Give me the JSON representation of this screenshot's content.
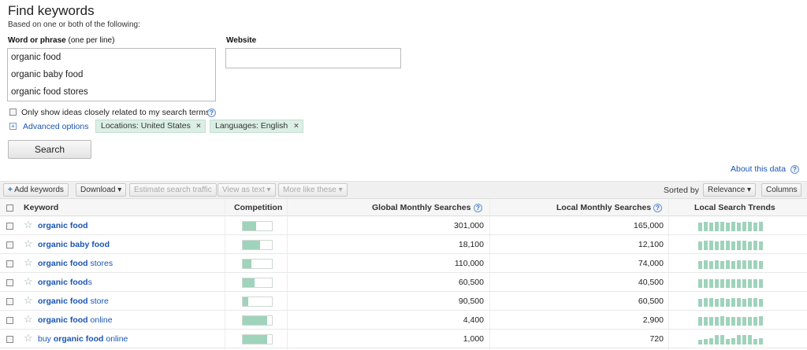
{
  "form": {
    "title": "Find keywords",
    "subtitle": "Based on one or both of the following:",
    "phrase_label_bold": "Word or phrase",
    "phrase_label_rest": " (one per line)",
    "phrases": [
      "organic food",
      "organic baby food",
      "organic food stores"
    ],
    "website_label": "Website",
    "website_value": "",
    "only_related_label": "Only show ideas closely related to my search terms",
    "help_glyph": "?",
    "advanced_label": "Advanced options",
    "location_chip": "Locations: United States",
    "language_chip": "Languages: English",
    "chip_close": "×",
    "search_button": "Search",
    "about_link": "About this data"
  },
  "toolbar": {
    "add_keywords": "Add keywords",
    "download": "Download ▾",
    "estimate": "Estimate search traffic",
    "view_as_text": "View as text ▾",
    "more_like": "More like these ▾",
    "sorted_by": "Sorted by",
    "relevance": "Relevance ▾",
    "columns": "Columns"
  },
  "table": {
    "headers": {
      "keyword": "Keyword",
      "competition": "Competition",
      "global": "Global Monthly Searches",
      "local": "Local Monthly Searches",
      "trends": "Local Search Trends"
    },
    "rows": [
      {
        "pre": "",
        "bold": "organic food",
        "post": "",
        "competition": 0.45,
        "global": "301,000",
        "local": "165,000",
        "trend": [
          0.8,
          0.85,
          0.8,
          0.85,
          0.85,
          0.8,
          0.85,
          0.8,
          0.85,
          0.85,
          0.8,
          0.85
        ]
      },
      {
        "pre": "",
        "bold": "organic baby food",
        "post": "",
        "competition": 0.6,
        "global": "18,100",
        "local": "12,100",
        "trend": [
          0.8,
          0.85,
          0.85,
          0.8,
          0.85,
          0.85,
          0.8,
          0.85,
          0.85,
          0.8,
          0.85,
          0.8
        ]
      },
      {
        "pre": "",
        "bold": "organic food",
        "post": " stores",
        "competition": 0.3,
        "global": "110,000",
        "local": "74,000",
        "trend": [
          0.7,
          0.75,
          0.7,
          0.75,
          0.7,
          0.75,
          0.7,
          0.75,
          0.8,
          0.75,
          0.8,
          0.7
        ]
      },
      {
        "pre": "",
        "bold": "organic food",
        "post": "s",
        "competition": 0.4,
        "global": "60,500",
        "local": "40,500",
        "trend": [
          0.75,
          0.8,
          0.75,
          0.8,
          0.8,
          0.75,
          0.8,
          0.75,
          0.8,
          0.8,
          0.75,
          0.8
        ]
      },
      {
        "pre": "",
        "bold": "organic food",
        "post": " store",
        "competition": 0.2,
        "global": "90,500",
        "local": "60,500",
        "trend": [
          0.7,
          0.75,
          0.75,
          0.7,
          0.75,
          0.7,
          0.75,
          0.75,
          0.7,
          0.75,
          0.75,
          0.7
        ]
      },
      {
        "pre": "",
        "bold": "organic food",
        "post": " online",
        "competition": 0.85,
        "global": "4,400",
        "local": "2,900",
        "trend": [
          0.8,
          0.8,
          0.75,
          0.8,
          0.85,
          0.8,
          0.75,
          0.8,
          0.8,
          0.75,
          0.8,
          0.85
        ]
      },
      {
        "pre": "buy ",
        "bold": "organic food",
        "post": " online",
        "competition": 0.85,
        "global": "1,000",
        "local": "720",
        "trend": [
          0.4,
          0.5,
          0.6,
          0.85,
          0.85,
          0.5,
          0.6,
          0.85,
          0.85,
          0.85,
          0.5,
          0.6
        ]
      }
    ]
  },
  "colors": {
    "accent_green": "#9fd3bb",
    "link_blue": "#1a55b5"
  }
}
